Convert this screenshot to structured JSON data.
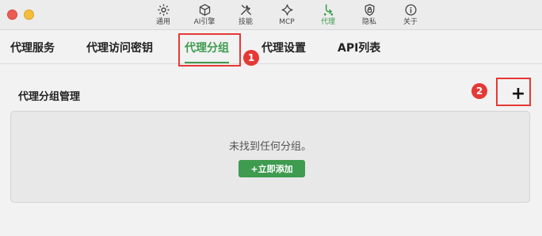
{
  "window": {
    "controls": [
      "close",
      "minimize"
    ]
  },
  "toolbar": {
    "items": [
      {
        "label": "通用",
        "icon": "gear-icon"
      },
      {
        "label": "AI引擎",
        "icon": "cube-icon"
      },
      {
        "label": "技能",
        "icon": "tools-icon"
      },
      {
        "label": "MCP",
        "icon": "sparkle-icon"
      },
      {
        "label": "代理",
        "icon": "proxy-icon",
        "active": true
      },
      {
        "label": "隐私",
        "icon": "shield-icon"
      },
      {
        "label": "关于",
        "icon": "info-icon"
      }
    ]
  },
  "tabs": [
    {
      "label": "代理服务"
    },
    {
      "label": "代理访问密钥"
    },
    {
      "label": "代理分组",
      "active": true
    },
    {
      "label": "代理设置"
    },
    {
      "label": "API列表"
    }
  ],
  "section": {
    "title": "代理分组管理",
    "add_label": "+",
    "empty_text": "未找到任何分组。",
    "create_label": "+立即添加"
  },
  "annotations": [
    {
      "number": "1"
    },
    {
      "number": "2"
    }
  ],
  "colors": {
    "accent": "#3e9b4f",
    "annotation": "#e53935",
    "background": "#f2f2f2",
    "panel": "#e8e8e8"
  }
}
